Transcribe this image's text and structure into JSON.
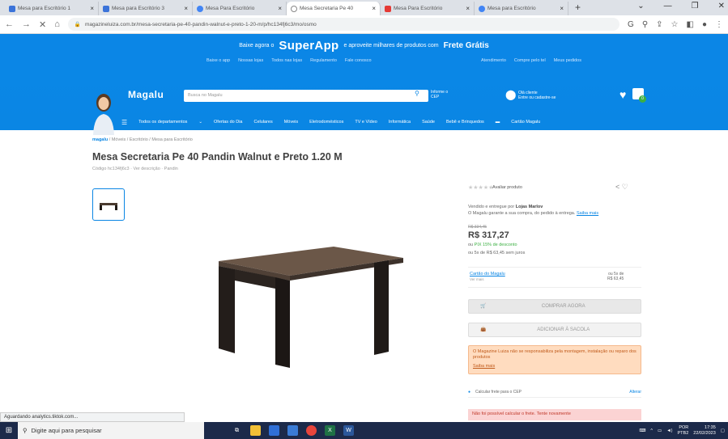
{
  "browser": {
    "tabs": [
      {
        "label": "Mesa para Escritório 1",
        "color": "#3b73d9"
      },
      {
        "label": "Mesa para Escritório 3",
        "color": "#3b73d9"
      },
      {
        "label": "Mesa Para Escritório",
        "color": "#4285f4"
      },
      {
        "label": "Mesa Secretaria Pe 40",
        "color": "#888888"
      },
      {
        "label": "Mesa Para Escritório",
        "color": "#e53935"
      },
      {
        "label": "Mesa para Escritório",
        "color": "#4285f4"
      }
    ],
    "url": "magazineluiza.com.br/mesa-secretaria-pe-40-pandin-walnut-e-preto-1-20-m/p/hc134fj6c3/mo/osmo",
    "new_tab": "+"
  },
  "banner": {
    "pre": "Baixe agora o",
    "app": "SuperApp",
    "mid": "e aproveite milhares de produtos com",
    "frete": "Frete Grátis",
    "links": [
      "Baixe o app",
      "Nossas lojas",
      "Todos nas lojas",
      "Regulamento",
      "Fale conosco"
    ],
    "links2": [
      "Atendimento",
      "Compre pelo tel",
      "Meus pedidos"
    ]
  },
  "header": {
    "logo": "Magalu",
    "search_placeholder": "Busca no Magalu",
    "cep_line1": "Informe o",
    "cep_line2": "CEP",
    "login_line1": "Olá cliente",
    "login_line2": "Entre ou cadastre-se"
  },
  "categories": [
    "Todos os departamentos",
    "Ofertas do Dia",
    "Celulares",
    "Móveis",
    "Eletrodomésticos",
    "TV e Vídeo",
    "Informática",
    "Saúde",
    "Bebê e Brinquedos",
    "Cartão Magalu"
  ],
  "product": {
    "breadcrumb_home": "magalu",
    "breadcrumb": "/ Móveis / Escritório / Mesa para Escritório",
    "title": "Mesa Secretaria Pe 40 Pandin Walnut e Preto 1.20 M",
    "codigo": "Código hc134fj6c3 · Ver descrição · Pandin",
    "rating_text": "Avaliar produto",
    "sold_by_prefix": "Vendido e entregue por",
    "sold_by": "Lojas Marlov",
    "guarantee": "O Magalu garante a sua compra, do pedido à entrega.",
    "guarantee_link": "Saiba mais",
    "old_price": "R$ 334,45",
    "price": "R$ 317,27",
    "pix_prefix": "ou",
    "pix": "PIX 15% de desconto",
    "installments": "ou 5x de R$ 63,45 sem juros",
    "card_label": "Cartão do Magalu",
    "card_sub": "Ver mais",
    "card_value_l1": "ou 5x de",
    "card_value_l2": "R$ 63,45",
    "buy_button": "COMPRAR AGORA",
    "bag_button": "ADICIONAR À SACOLA",
    "alert_text": "O Magazine Luiza não se responsabiliza pela montagem, instalação ou reparo dos produtos",
    "alert_link": "Saiba mais",
    "cep_text": "Calcular frete para o CEP",
    "cep_link": "Alterar",
    "red_banner": "Não foi possível calcular o frete. Tente novamente"
  },
  "status_text": "Aguardando analytics.tiktok.com...",
  "taskbar": {
    "search_placeholder": "Digite aqui para pesquisar",
    "lang_l1": "POR",
    "lang_l2": "PTB2",
    "time": "17:35",
    "date": "22/02/2023"
  }
}
